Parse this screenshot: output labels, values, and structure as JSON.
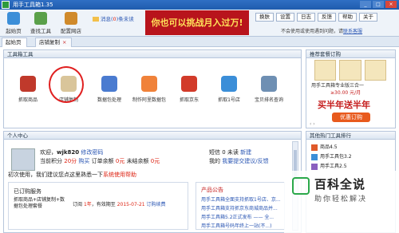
{
  "window": {
    "title": "用手工具箱1.35",
    "controls": [
      "_",
      "□",
      "×"
    ]
  },
  "toolbar": {
    "items": [
      {
        "label": "起始页",
        "icon": "home-icon",
        "color": "#3b8ed8"
      },
      {
        "label": "查找工具",
        "icon": "find-tool-icon",
        "color": "#5aa04a"
      },
      {
        "label": "配置网店",
        "icon": "configure-shop-icon",
        "color": "#d08a2b"
      }
    ],
    "messages": {
      "label": "消息(",
      "count": "0",
      "suffix": ")条未读"
    },
    "ad_text": "你也可以挑战月入过万!",
    "buttons": [
      "换肤",
      "设置",
      "日志",
      "反馈",
      "帮助",
      "关于"
    ],
    "notice": {
      "text": "不会使用或使用遇到问题，请",
      "link": "联系客服"
    }
  },
  "tabs": [
    {
      "label": "起始页"
    },
    {
      "label": "店铺复制",
      "closable": true
    }
  ],
  "tools_panel": {
    "title": "工具箱工具",
    "tools": [
      {
        "label": "抓取商品",
        "icon": "grab-product-icon",
        "color": "#c0392b"
      },
      {
        "label": "店铺复制",
        "icon": "shop-copy-icon",
        "color": "#d9c59a"
      },
      {
        "label": "数据包处理",
        "icon": "data-package-icon",
        "color": "#4a7bd0"
      },
      {
        "label": "制作阿里数据包",
        "icon": "alibaba-package-icon",
        "color": "#f0823a"
      },
      {
        "label": "抓取京东",
        "icon": "jd-icon",
        "color": "#d23b2a"
      },
      {
        "label": "抓取1号店",
        "icon": "yhd-icon",
        "color": "#3b8ed8"
      },
      {
        "label": "宝贝排名查询",
        "icon": "rank-query-icon",
        "color": "#6e8fb3"
      }
    ]
  },
  "promo_panel": {
    "title": "推荐套餐订购",
    "line1": "用手工具箱专业版三合一",
    "line2": "≥30.00 元/月",
    "big": "买半年送半年",
    "button": "优惠订购",
    "arrows": "‹   ›"
  },
  "user_panel": {
    "title": "个人中心",
    "greeting": "欢迎，",
    "username": "wjk820",
    "edit_link": "修改密码",
    "points_label": "当前积分",
    "points": "20分",
    "buy_label": "购买",
    "order_label": "订单余额",
    "order_value": "0元",
    "unsettled_label": "未结余额",
    "unsettled_value": "0元",
    "side1": "短信 0 未读",
    "side1_link": "新建",
    "side2": "我的",
    "side2_link": "我要提交建议/反馈",
    "intro": "初次使用，我们建议您点这里熟悉一下",
    "intro_link": "系统使用帮助",
    "subscribed_title": "已订购服务",
    "service_name": "抓取商品+店铺复制+数据包处理套餐",
    "subscribe_label": "订阅",
    "subscribe_period": "1年",
    "expiry_label": "，有效期至",
    "expiry": "2015-07-21",
    "renew": "订购续费"
  },
  "product_notice": {
    "title": "产品公告",
    "items": [
      "用手工具箱全面支持抓取1号店、京...",
      "用手工具箱支持抓京东商城商品并...",
      "用手工具箱5.2正式发布 —— 全...",
      "用手工具箱号码年终上一站(不...)"
    ]
  },
  "ranking_panel": {
    "title": "其他热门工具排行",
    "items": [
      {
        "name": "商品4.5",
        "color": "#e05a2a"
      },
      {
        "name": "用手工具包3.2",
        "color": "#3b8ed8"
      },
      {
        "name": "用手工具2.5",
        "color": "#8a5fbf"
      }
    ]
  },
  "watermark": {
    "title": "百科全说",
    "subtitle": "助你轻松解决"
  }
}
